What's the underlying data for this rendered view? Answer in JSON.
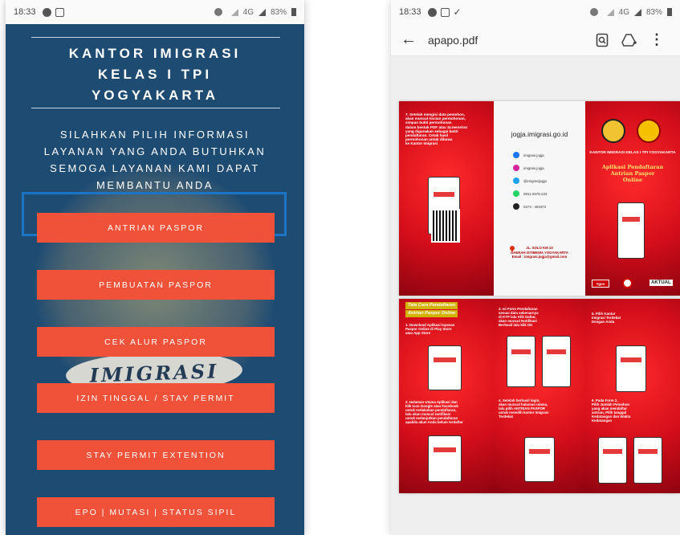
{
  "left_phone": {
    "status_bar": {
      "time": "18:33",
      "network": "4G",
      "battery": "83%"
    },
    "office_title": [
      "KANTOR IMIGRASI",
      "KELAS I TPI",
      "YOGYAKARTA"
    ],
    "info_text": [
      "SILAHKAN PILIH INFORMASI",
      "LAYANAN YANG ANDA BUTUHKAN",
      "SEMOGA LAYANAN KAMI DAPAT",
      "MEMBANTU ANDA"
    ],
    "background_ribbon": "IMIGRASI",
    "menu": [
      {
        "label": "ANTRIAN PASPOR",
        "highlighted": true
      },
      {
        "label": "PEMBUATAN PASPOR",
        "highlighted": false
      },
      {
        "label": "CEK ALUR PASPOR",
        "highlighted": false
      },
      {
        "label": "IZIN TINGGAL / STAY PERMIT",
        "highlighted": false
      },
      {
        "label": "STAY PERMIT EXTENTION",
        "highlighted": false
      },
      {
        "label": "EPO | MUTASI | STATUS SIPIL",
        "highlighted": false
      }
    ],
    "colors": {
      "background": "#1e4b72",
      "button": "#ef5238",
      "highlight_border": "#1b74c4"
    }
  },
  "right_phone": {
    "status_bar": {
      "time": "18:33",
      "network": "4G",
      "battery": "83%"
    },
    "app_bar": {
      "file_name": "apapo.pdf",
      "icons": [
        "back-arrow-icon",
        "search-document-icon",
        "drive-add-icon",
        "more-vert-icon"
      ]
    },
    "brochure_page1": {
      "step7_text": [
        "7. Setelah mengisi data pemohon,",
        "akan muncul rincian permohonan,",
        "simpan bukti permohonan",
        "dalam bentuk PDF atau Screenshot",
        "yang digunakan sebagai bukti",
        "pendaftaran. Cetak hasil",
        "permohonan untuk dibawa",
        "ke Kantor Imigrasi"
      ],
      "website": "jogja.imigrasi.go.id",
      "social": [
        {
          "icon": "facebook-icon",
          "text": "imigrasi.jogja",
          "color": "#1877f2"
        },
        {
          "icon": "instagram-icon",
          "text": "imigrasi.jogja",
          "color": "#d6249f"
        },
        {
          "icon": "twitter-icon",
          "text": "@imigrasijogja",
          "color": "#1da1f2"
        },
        {
          "icon": "whatsapp-icon",
          "text": "0811-2578-223",
          "color": "#25d366"
        },
        {
          "icon": "phone-icon",
          "text": "0274 - 484372",
          "color": "#222222"
        }
      ],
      "address": [
        "JL. SOLO KM 10",
        "DAERAH ISTIMEWA YOGYAKARTA",
        "Email : imigrasi.jogja@gmail.com"
      ],
      "cover_office": "KANTOR IMIGRASI KELAS I TPI YOGYAKARTA",
      "cover_title": [
        "Aplikasi Pendaftaran",
        "Antrian Paspor",
        "Online"
      ],
      "cover_logos": [
        "#gov",
        "AKTUAL"
      ]
    },
    "brochure_page2": {
      "heading": [
        "Tata Cara Pendaftaran",
        "Antrian Paspor Online"
      ],
      "step1": [
        "1. Download Aplikasi layanan",
        "Paspor Online di Play Store",
        "atau App Store"
      ],
      "step2": [
        "2. Halaman Utama Aplikasi dan",
        "klik Icon Google atau Facebook",
        "untuk melakukan pendaftaran,",
        "lalu akan muncul notifikasi",
        "untuk melanjutkan pendaftaran",
        "apabila akun Anda belum terdaftar"
      ],
      "step3": [
        "3. Isi Form Pendaftaran",
        "sesuai data sebenarnya",
        "di KTP lalu Klik Daftar,",
        "akan muncul Notifikasi",
        "Berhasil lalu klik OK"
      ],
      "step4": [
        "4. Setelah berhasil login,",
        "akan muncul halaman utama,",
        "lalu pilih ANTRIAN PASPOR",
        "untuk memilih kantor Imigrasi",
        "Terdekat"
      ],
      "step5": [
        "5. Pilih Kantor",
        "Imigrasi Terdekat",
        "Dengan Anda"
      ],
      "step6": [
        "6. Pada Form 2,",
        "Pilih Jumlah Pemohon",
        "yang akan mendaftar",
        "antrian, Pilih tanggal",
        "Kedatangan dan Waktu",
        "Kedatangan"
      ]
    }
  }
}
